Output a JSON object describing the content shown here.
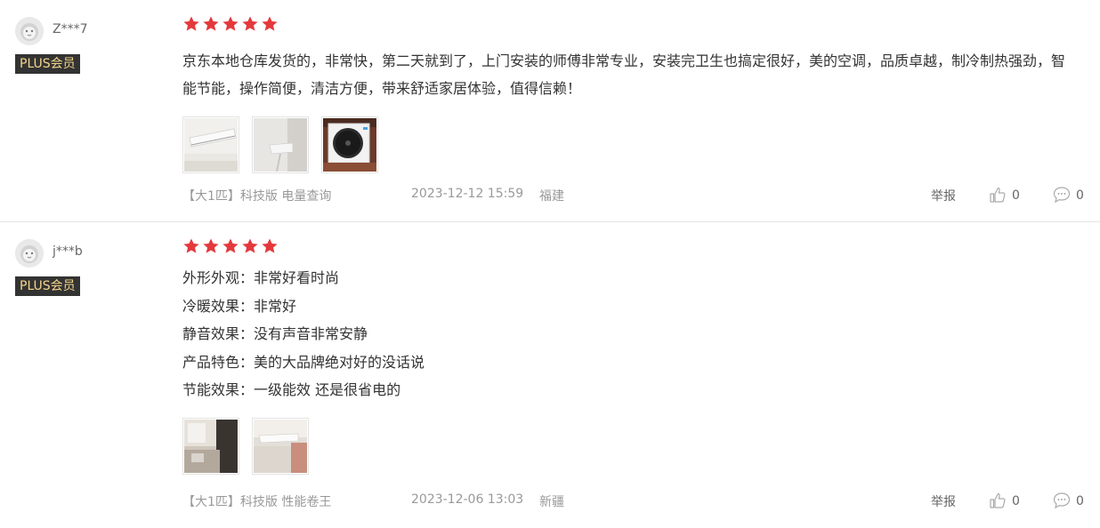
{
  "reviews": [
    {
      "username": "Z***7",
      "badge": "PLUS会员",
      "rating": 5,
      "comment": "京东本地仓库发货的，非常快，第二天就到了，上门安装的师傅非常专业，安装完卫生也搞定很好，美的空调，品质卓越，制冷制热强劲，智能节能，操作简便，清洁方便，带来舒适家居体验，值得信赖！",
      "photos": [
        "ac-indoor-unit-photo",
        "ac-wall-unit-photo",
        "ac-outdoor-unit-photo"
      ],
      "spec": "【大1匹】科技版 电量查询",
      "date": "2023-12-12 15:59",
      "location": "福建",
      "report_label": "举报",
      "likes": "0",
      "replies": "0"
    },
    {
      "username": "j***b",
      "badge": "PLUS会员",
      "rating": 5,
      "comment_lines": [
        "外形外观：非常好看时尚",
        "冷暖效果：非常好",
        "静音效果：没有声音非常安静",
        "产品特色：美的大品牌绝对好的没话说",
        "节能效果：一级能效 还是很省电的"
      ],
      "photos": [
        "room-interior-photo",
        "ac-wall-unit-photo"
      ],
      "spec": "【大1匹】科技版 性能卷王",
      "date": "2023-12-06 13:03",
      "location": "新疆",
      "report_label": "举报",
      "likes": "0",
      "replies": "0"
    }
  ],
  "colors": {
    "star": "#e4393c",
    "badge_bg": "#333333",
    "badge_text": "#f5d58a",
    "meta_text": "#999999"
  },
  "icons": [
    "star-icon",
    "thumbs-up-icon",
    "comment-bubble-icon",
    "lion-avatar-icon"
  ]
}
